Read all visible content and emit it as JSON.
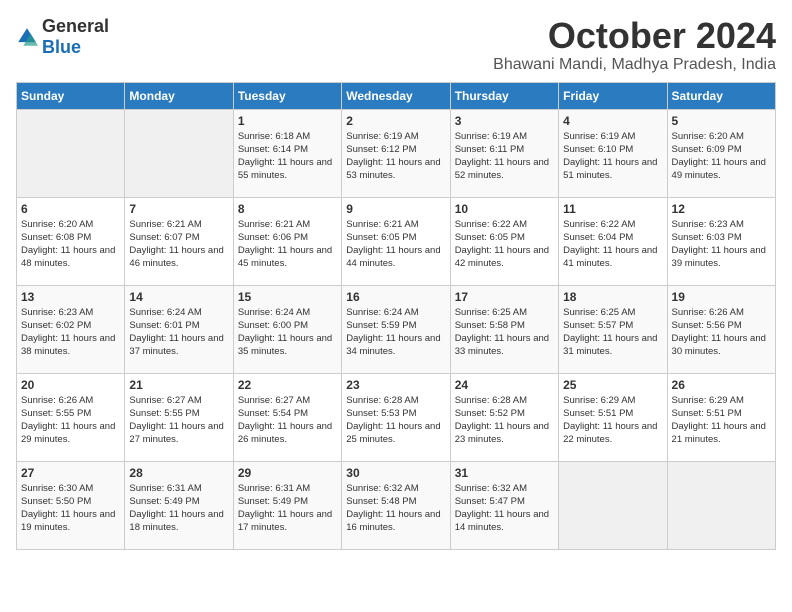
{
  "header": {
    "logo_general": "General",
    "logo_blue": "Blue",
    "month_title": "October 2024",
    "location": "Bhawani Mandi, Madhya Pradesh, India"
  },
  "days_of_week": [
    "Sunday",
    "Monday",
    "Tuesday",
    "Wednesday",
    "Thursday",
    "Friday",
    "Saturday"
  ],
  "weeks": [
    [
      {
        "day": "",
        "info": ""
      },
      {
        "day": "",
        "info": ""
      },
      {
        "day": "1",
        "info": "Sunrise: 6:18 AM\nSunset: 6:14 PM\nDaylight: 11 hours and 55 minutes."
      },
      {
        "day": "2",
        "info": "Sunrise: 6:19 AM\nSunset: 6:12 PM\nDaylight: 11 hours and 53 minutes."
      },
      {
        "day": "3",
        "info": "Sunrise: 6:19 AM\nSunset: 6:11 PM\nDaylight: 11 hours and 52 minutes."
      },
      {
        "day": "4",
        "info": "Sunrise: 6:19 AM\nSunset: 6:10 PM\nDaylight: 11 hours and 51 minutes."
      },
      {
        "day": "5",
        "info": "Sunrise: 6:20 AM\nSunset: 6:09 PM\nDaylight: 11 hours and 49 minutes."
      }
    ],
    [
      {
        "day": "6",
        "info": "Sunrise: 6:20 AM\nSunset: 6:08 PM\nDaylight: 11 hours and 48 minutes."
      },
      {
        "day": "7",
        "info": "Sunrise: 6:21 AM\nSunset: 6:07 PM\nDaylight: 11 hours and 46 minutes."
      },
      {
        "day": "8",
        "info": "Sunrise: 6:21 AM\nSunset: 6:06 PM\nDaylight: 11 hours and 45 minutes."
      },
      {
        "day": "9",
        "info": "Sunrise: 6:21 AM\nSunset: 6:05 PM\nDaylight: 11 hours and 44 minutes."
      },
      {
        "day": "10",
        "info": "Sunrise: 6:22 AM\nSunset: 6:05 PM\nDaylight: 11 hours and 42 minutes."
      },
      {
        "day": "11",
        "info": "Sunrise: 6:22 AM\nSunset: 6:04 PM\nDaylight: 11 hours and 41 minutes."
      },
      {
        "day": "12",
        "info": "Sunrise: 6:23 AM\nSunset: 6:03 PM\nDaylight: 11 hours and 39 minutes."
      }
    ],
    [
      {
        "day": "13",
        "info": "Sunrise: 6:23 AM\nSunset: 6:02 PM\nDaylight: 11 hours and 38 minutes."
      },
      {
        "day": "14",
        "info": "Sunrise: 6:24 AM\nSunset: 6:01 PM\nDaylight: 11 hours and 37 minutes."
      },
      {
        "day": "15",
        "info": "Sunrise: 6:24 AM\nSunset: 6:00 PM\nDaylight: 11 hours and 35 minutes."
      },
      {
        "day": "16",
        "info": "Sunrise: 6:24 AM\nSunset: 5:59 PM\nDaylight: 11 hours and 34 minutes."
      },
      {
        "day": "17",
        "info": "Sunrise: 6:25 AM\nSunset: 5:58 PM\nDaylight: 11 hours and 33 minutes."
      },
      {
        "day": "18",
        "info": "Sunrise: 6:25 AM\nSunset: 5:57 PM\nDaylight: 11 hours and 31 minutes."
      },
      {
        "day": "19",
        "info": "Sunrise: 6:26 AM\nSunset: 5:56 PM\nDaylight: 11 hours and 30 minutes."
      }
    ],
    [
      {
        "day": "20",
        "info": "Sunrise: 6:26 AM\nSunset: 5:55 PM\nDaylight: 11 hours and 29 minutes."
      },
      {
        "day": "21",
        "info": "Sunrise: 6:27 AM\nSunset: 5:55 PM\nDaylight: 11 hours and 27 minutes."
      },
      {
        "day": "22",
        "info": "Sunrise: 6:27 AM\nSunset: 5:54 PM\nDaylight: 11 hours and 26 minutes."
      },
      {
        "day": "23",
        "info": "Sunrise: 6:28 AM\nSunset: 5:53 PM\nDaylight: 11 hours and 25 minutes."
      },
      {
        "day": "24",
        "info": "Sunrise: 6:28 AM\nSunset: 5:52 PM\nDaylight: 11 hours and 23 minutes."
      },
      {
        "day": "25",
        "info": "Sunrise: 6:29 AM\nSunset: 5:51 PM\nDaylight: 11 hours and 22 minutes."
      },
      {
        "day": "26",
        "info": "Sunrise: 6:29 AM\nSunset: 5:51 PM\nDaylight: 11 hours and 21 minutes."
      }
    ],
    [
      {
        "day": "27",
        "info": "Sunrise: 6:30 AM\nSunset: 5:50 PM\nDaylight: 11 hours and 19 minutes."
      },
      {
        "day": "28",
        "info": "Sunrise: 6:31 AM\nSunset: 5:49 PM\nDaylight: 11 hours and 18 minutes."
      },
      {
        "day": "29",
        "info": "Sunrise: 6:31 AM\nSunset: 5:49 PM\nDaylight: 11 hours and 17 minutes."
      },
      {
        "day": "30",
        "info": "Sunrise: 6:32 AM\nSunset: 5:48 PM\nDaylight: 11 hours and 16 minutes."
      },
      {
        "day": "31",
        "info": "Sunrise: 6:32 AM\nSunset: 5:47 PM\nDaylight: 11 hours and 14 minutes."
      },
      {
        "day": "",
        "info": ""
      },
      {
        "day": "",
        "info": ""
      }
    ]
  ]
}
